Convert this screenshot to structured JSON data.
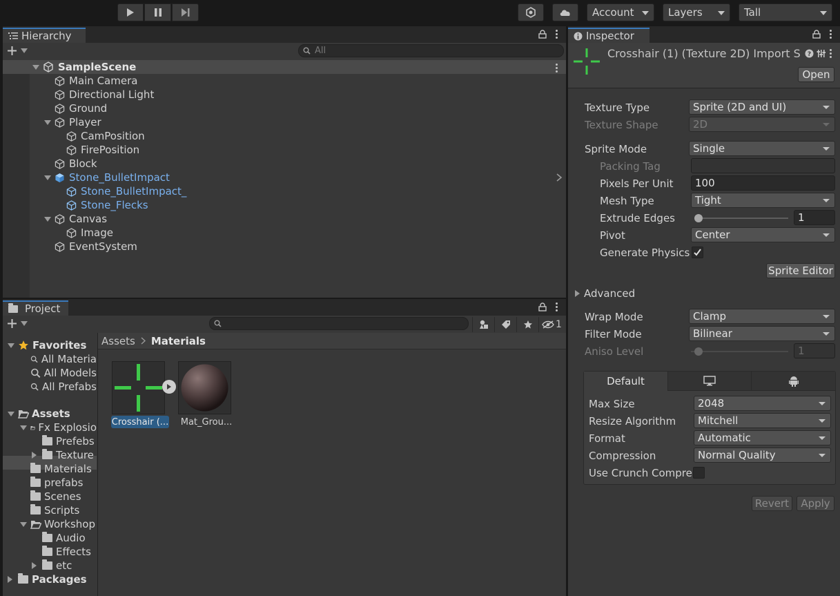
{
  "toolbar": {
    "account": "Account",
    "layers": "Layers",
    "layout": "Tall"
  },
  "hierarchy": {
    "tab": "Hierarchy",
    "search_placeholder": "All",
    "scene": "SampleScene",
    "items": [
      {
        "label": "Main Camera"
      },
      {
        "label": "Directional Light"
      },
      {
        "label": "Ground"
      },
      {
        "label": "Player"
      },
      {
        "label": "CamPosition"
      },
      {
        "label": "FirePosition"
      },
      {
        "label": "Block"
      },
      {
        "label": "Stone_BulletImpact"
      },
      {
        "label": "Stone_BulletImpact_"
      },
      {
        "label": "Stone_Flecks"
      },
      {
        "label": "Canvas"
      },
      {
        "label": "Image"
      },
      {
        "label": "EventSystem"
      }
    ]
  },
  "project": {
    "tab": "Project",
    "hidden_count": "1",
    "tree": [
      {
        "label": "Favorites"
      },
      {
        "label": "All Materia"
      },
      {
        "label": "All Models"
      },
      {
        "label": "All Prefabs"
      },
      {
        "label": "Assets"
      },
      {
        "label": "Fx Explosio"
      },
      {
        "label": "Prefebs"
      },
      {
        "label": "Texture"
      },
      {
        "label": "Materials"
      },
      {
        "label": "prefabs"
      },
      {
        "label": "Scenes"
      },
      {
        "label": "Scripts"
      },
      {
        "label": "Workshop"
      },
      {
        "label": "Audio"
      },
      {
        "label": "Effects"
      },
      {
        "label": "etc"
      },
      {
        "label": "Packages"
      }
    ],
    "breadcrumb": {
      "root": "Assets",
      "current": "Materials"
    },
    "assets": [
      {
        "label": "Crosshair (..."
      },
      {
        "label": "Mat_Grou..."
      }
    ]
  },
  "inspector": {
    "tab": "Inspector",
    "title": "Crosshair (1) (Texture 2D) Import S",
    "open_button": "Open",
    "texture_type": {
      "label": "Texture Type",
      "value": "Sprite (2D and UI)"
    },
    "texture_shape": {
      "label": "Texture Shape",
      "value": "2D"
    },
    "sprite_mode": {
      "label": "Sprite Mode",
      "value": "Single"
    },
    "packing_tag": {
      "label": "Packing Tag",
      "value": ""
    },
    "pixels_per_unit": {
      "label": "Pixels Per Unit",
      "value": "100"
    },
    "mesh_type": {
      "label": "Mesh Type",
      "value": "Tight"
    },
    "extrude_edges": {
      "label": "Extrude Edges",
      "value": "1"
    },
    "pivot": {
      "label": "Pivot",
      "value": "Center"
    },
    "generate_physics": {
      "label": "Generate Physics",
      "checked": true
    },
    "sprite_editor_button": "Sprite Editor",
    "advanced": "Advanced",
    "wrap_mode": {
      "label": "Wrap Mode",
      "value": "Clamp"
    },
    "filter_mode": {
      "label": "Filter Mode",
      "value": "Bilinear"
    },
    "aniso_level": {
      "label": "Aniso Level",
      "value": "1"
    },
    "platform_tabs": {
      "default": "Default"
    },
    "max_size": {
      "label": "Max Size",
      "value": "2048"
    },
    "resize_algorithm": {
      "label": "Resize Algorithm",
      "value": "Mitchell"
    },
    "format": {
      "label": "Format",
      "value": "Automatic"
    },
    "compression": {
      "label": "Compression",
      "value": "Normal Quality"
    },
    "use_crunch": {
      "label": "Use Crunch Compres",
      "checked": false
    },
    "revert_button": "Revert",
    "apply_button": "Apply"
  },
  "colors": {
    "accent_blue": "#3a79bb",
    "prefab_blue": "#7ab1ee",
    "crosshair_green": "#3fc94a"
  }
}
